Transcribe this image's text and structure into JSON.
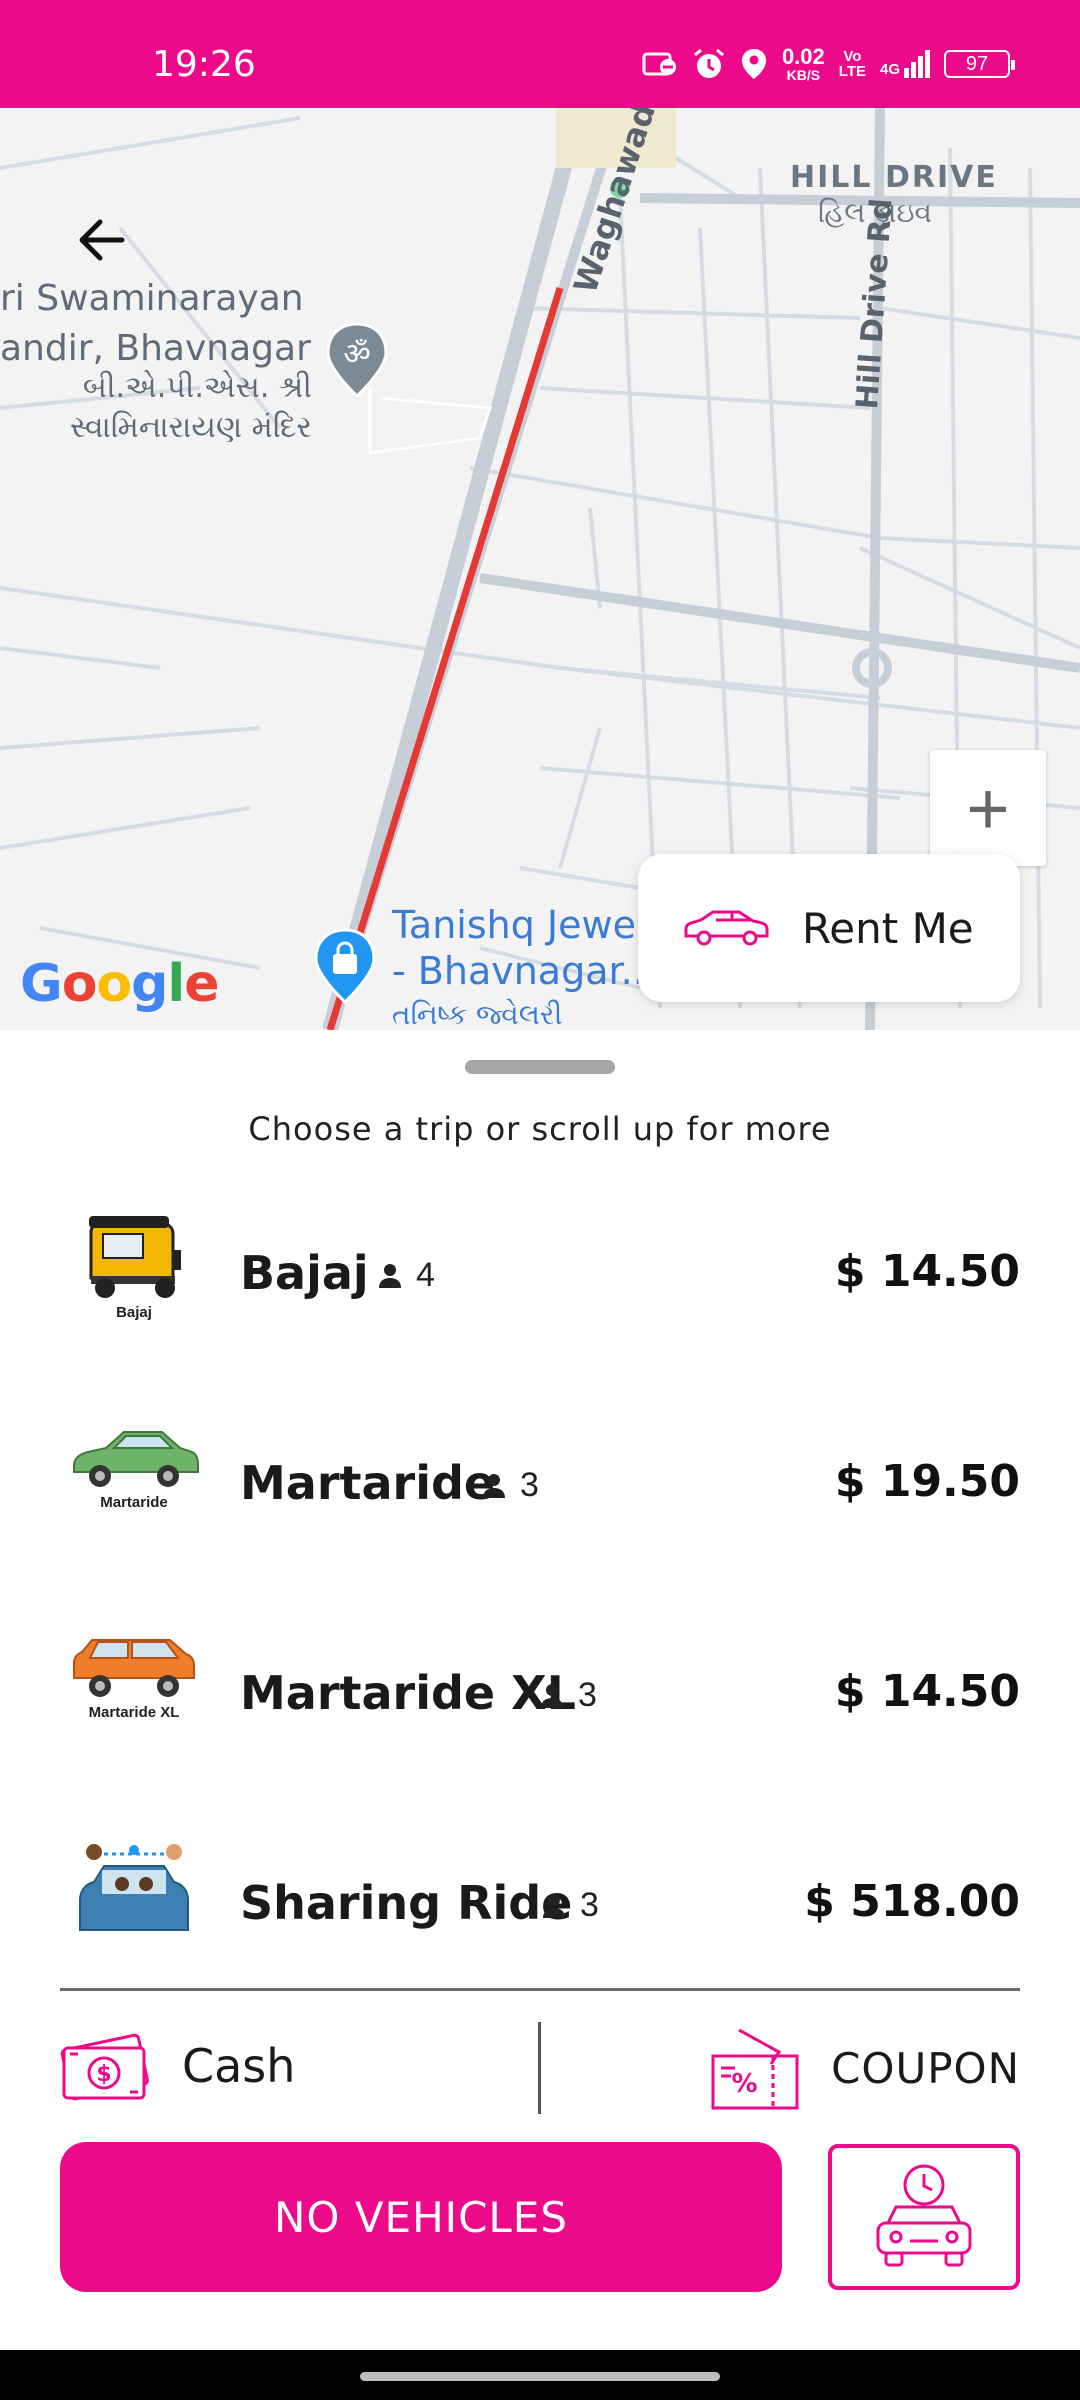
{
  "status_bar": {
    "time": "19:26",
    "net_speed": "0.02",
    "net_unit": "KB/S",
    "volte_top": "Vo",
    "volte_bottom": "LTE",
    "network": "4G",
    "battery": "97",
    "icons": [
      "do-not-disturb-icon",
      "alarm-icon",
      "location-icon",
      "signal-icon",
      "battery-icon"
    ]
  },
  "map": {
    "labels": {
      "temple_en_line1": "ri Swaminarayan",
      "temple_en_line2": "andir, Bhavnagar",
      "temple_gu_line1": "બી.એ.પી.એસ. શ્રી",
      "temple_gu_line2": "સ્વામિનારાયણ મંદિર",
      "hill_drive_en": "HILL DRIVE",
      "hill_drive_gu": "હિલ ડ્રાઇવ",
      "hill_drive_rd": "Hill Drive Rd",
      "waghawadi": "Waghawadi",
      "tanishq_line1": "Tanishq Jewe",
      "tanishq_line2": "- Bhavnagar...",
      "tanishq_gu": "તનિષ્ક જ્વેલરી"
    },
    "google": [
      "G",
      "o",
      "o",
      "g",
      "l",
      "e"
    ],
    "google_colors": [
      "#4285F4",
      "#EA4335",
      "#FBBC05",
      "#4285F4",
      "#34A853",
      "#EA4335"
    ],
    "zoom_in": "+",
    "route_color": "#e53935"
  },
  "rent_card": {
    "label": "Rent Me"
  },
  "sheet": {
    "hint": "Choose a trip or scroll up for more",
    "rides": [
      {
        "name": "Bajaj",
        "seats": "4",
        "price": "$ 14.50",
        "caption": "Bajaj"
      },
      {
        "name": "Martaride",
        "seats": "3",
        "price": "$ 19.50",
        "caption": "Martaride"
      },
      {
        "name": "Martaride XL",
        "seats": "3",
        "price": "$ 14.50",
        "caption": "Martaride XL"
      },
      {
        "name": "Sharing Ride",
        "seats": "3",
        "price": "$ 518.00",
        "caption": ""
      }
    ]
  },
  "payment": {
    "method": "Cash",
    "coupon": "COUPON"
  },
  "actions": {
    "primary": "NO VEHICLES"
  },
  "colors": {
    "accent": "#ec0a8b"
  }
}
